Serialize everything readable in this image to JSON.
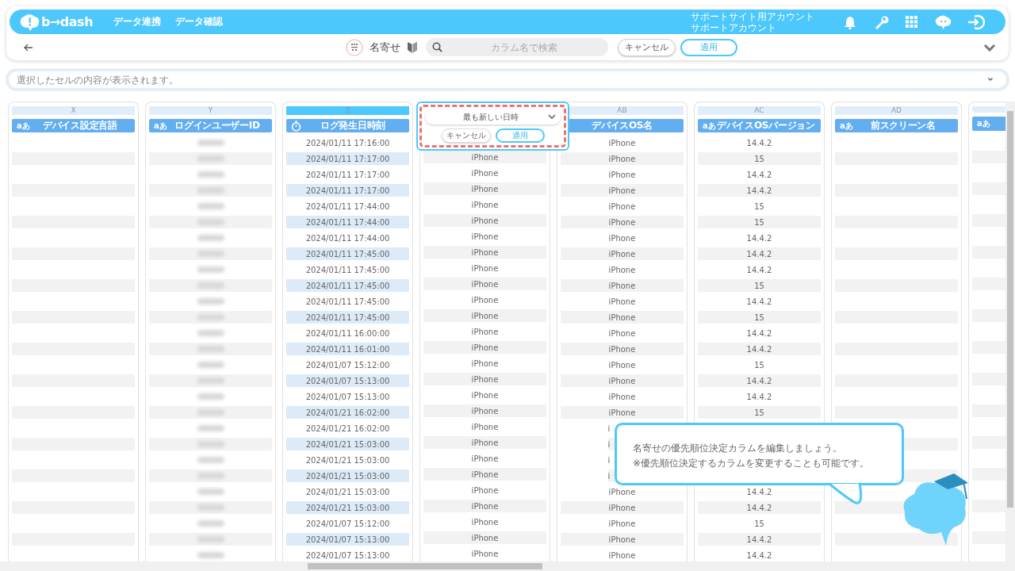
{
  "header": {
    "logo": "b→dash",
    "nav": [
      "データ連携",
      "データ確認"
    ],
    "account": [
      "サポートサイト用アカウント",
      "サポートアカウント"
    ]
  },
  "toolbar": {
    "title": "名寄せ",
    "search": {
      "placeholder": "カラム名で検索"
    },
    "cancel": "キャンセル",
    "apply": "適用"
  },
  "cell_bar": {
    "placeholder": "選択したセルの内容が表示されます。"
  },
  "columns": [
    {
      "letter": "X",
      "title": "デバイス設定言語",
      "type": {
        "kind": "text",
        "label": "aあ"
      },
      "selected": false,
      "kind": "empty"
    },
    {
      "letter": "Y",
      "title": "ログインユーザーID",
      "type": {
        "kind": "text",
        "label": "aあ"
      },
      "selected": false,
      "kind": "blurred"
    },
    {
      "letter": "Z",
      "title": "ログ発生日時刻",
      "type": {
        "kind": "clock"
      },
      "selected": true,
      "kind": "values",
      "cells": [
        "2024/01/11 17:16:00",
        "2024/01/11 17:17:00",
        "2024/01/11 17:17:00",
        "2024/01/11 17:17:00",
        "2024/01/11 17:44:00",
        "2024/01/11 17:44:00",
        "2024/01/11 17:44:00",
        "2024/01/11 17:45:00",
        "2024/01/11 17:45:00",
        "2024/01/11 17:45:00",
        "2024/01/11 17:45:00",
        "2024/01/11 17:45:00",
        "2024/01/11 16:00:00",
        "2024/01/11 16:01:00",
        "2024/01/07 15:12:00",
        "2024/01/07 15:13:00",
        "2024/01/07 15:13:00",
        "2024/01/21 16:02:00",
        "2024/01/21 16:02:00",
        "2024/01/21 15:03:00",
        "2024/01/21 15:03:00",
        "2024/01/21 15:03:00",
        "2024/01/21 15:03:00",
        "2024/01/21 15:03:00",
        "2024/01/07 15:12:00",
        "2024/01/07 15:13:00",
        "2024/01/07 15:13:00"
      ]
    },
    {
      "kind": "values",
      "cells": [
        null,
        "iPhone",
        "iPhone",
        "iPhone",
        "iPhone",
        "iPhone",
        "iPhone",
        "iPhone",
        "iPhone",
        "iPhone",
        "iPhone",
        "iPhone",
        "iPhone",
        "iPhone",
        "iPhone",
        "iPhone",
        "iPhone",
        "iPhone",
        "iPhone",
        "iPhone",
        "iPhone",
        "iPhone",
        "iPhone",
        "iPhone",
        "iPhone",
        "iPhone",
        "iPhone"
      ]
    },
    {
      "letter": "AB",
      "title": "デバイスOS名",
      "selected": false,
      "kind": "values",
      "cells": [
        "iPhone",
        "iPhone",
        "iPhone",
        "iPhone",
        "iPhone",
        "iPhone",
        "iPhone",
        "iPhone",
        "iPhone",
        "iPhone",
        "iPhone",
        "iPhone",
        "iPhone",
        "iPhone",
        "iPhone",
        "iPhone",
        "iPhone",
        "iPhone",
        {
          "text": "i",
          "cut": true
        },
        {
          "text": "i",
          "cut": true
        },
        {
          "text": "i",
          "cut": true
        },
        {
          "text": "i",
          "cut": true
        },
        "iPhone",
        "iPhone",
        "iPhone",
        "iPhone",
        "iPhone"
      ]
    },
    {
      "letter": "AC",
      "title": "デバイスOSバージョン",
      "type": {
        "kind": "text",
        "label": "aあ"
      },
      "selected": false,
      "kind": "values",
      "cells": [
        "14.4.2",
        "15",
        "14.4.2",
        "14.4.2",
        "15",
        "15",
        "14.4.2",
        "14.4.2",
        "14.4.2",
        "15",
        "14.4.2",
        "15",
        "14.4.2",
        "14.4.2",
        "15",
        "14.4.2",
        "14.4.2",
        "15",
        null,
        null,
        null,
        null,
        "14.4.2",
        "14.4.2",
        "15",
        "14.4.2",
        "14.4.2"
      ]
    },
    {
      "letter": "AD",
      "title": "前スクリーン名",
      "type": {
        "kind": "text",
        "label": "aあ"
      },
      "selected": false,
      "kind": "empty"
    },
    {
      "type": {
        "kind": "text",
        "label": "aあ"
      },
      "selected": false,
      "kind": "empty"
    }
  ],
  "popover": {
    "select": "最も新しい日時",
    "cancel": "キャンセル",
    "apply": "適用"
  },
  "tooltip": {
    "lines": [
      "名寄せの優先順位決定カラムを編集しましょう。",
      "※優先順位決定するカラムを変更することも可能です。"
    ]
  }
}
